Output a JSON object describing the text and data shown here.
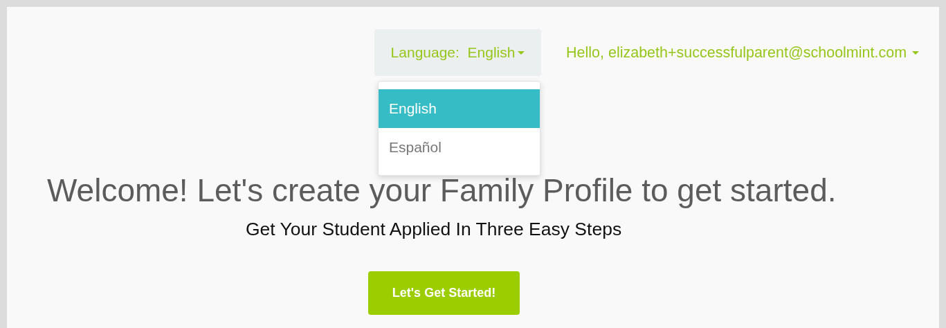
{
  "language_menu": {
    "label": "Language:",
    "value": "English",
    "expanded": true,
    "options": [
      {
        "label": "English",
        "selected": true
      },
      {
        "label": "Español",
        "selected": false
      }
    ]
  },
  "user_menu": {
    "label": "Hello, elizabeth+successfulparent@schoolmint.com"
  },
  "heading": "Welcome! Let's create your Family Profile to get started.",
  "subheading": "Get Your Student Applied In Three Easy Steps",
  "start_button": "Let's Get Started!"
}
